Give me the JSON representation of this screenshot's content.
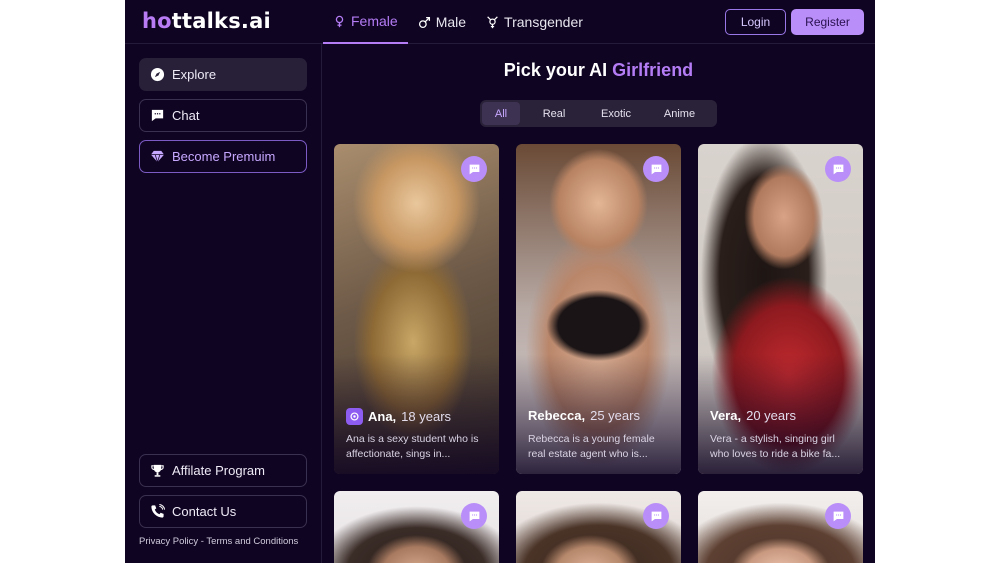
{
  "brand": {
    "logo_h": "h",
    "logo_o": "o",
    "logo_rest": "ttalks",
    "logo_ai": ".ai"
  },
  "nav": {
    "female": "Female",
    "male": "Male",
    "transgender": "Transgender"
  },
  "auth": {
    "login": "Login",
    "register": "Register"
  },
  "sidebar": {
    "explore": "Explore",
    "chat": "Chat",
    "premium": "Become Premuim",
    "affiliate": "Affilate Program",
    "contact": "Contact Us",
    "privacy": "Privacy Policy",
    "separator": " - ",
    "terms": "Terms and Conditions"
  },
  "main": {
    "heading_prefix": "Pick your AI ",
    "heading_accent": "Girlfriend",
    "filters": [
      "All",
      "Real",
      "Exotic",
      "Anime"
    ]
  },
  "cards": [
    {
      "name": "Ana,",
      "age": "18 years",
      "desc": "Ana is a sexy student who is affectionate, sings in..."
    },
    {
      "name": "Rebecca,",
      "age": "25 years",
      "desc": "Rebecca is a young female real estate agent who is..."
    },
    {
      "name": "Vera,",
      "age": "20 years",
      "desc": "Vera - a stylish, singing girl who loves to ride a bike fa..."
    }
  ],
  "colors": {
    "accent": "#b47cf5",
    "background": "#0f0422",
    "register_bg": "#b98ef8"
  }
}
